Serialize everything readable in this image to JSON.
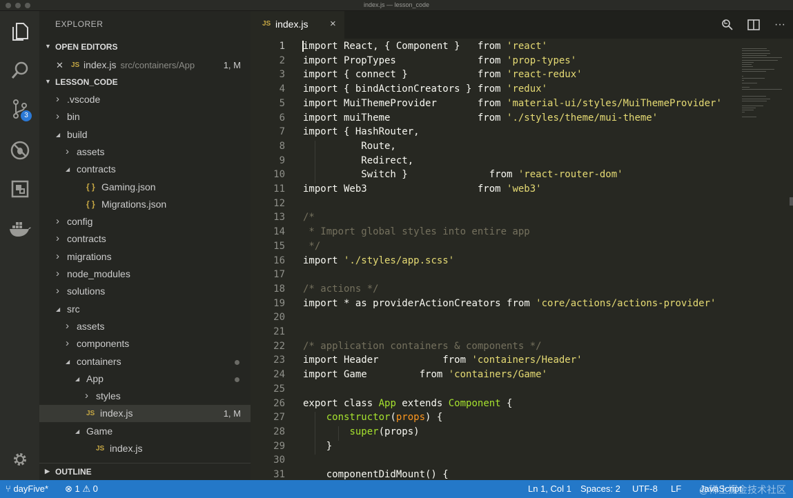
{
  "window": {
    "title": "index.js — lesson_code"
  },
  "activity": {
    "icons": [
      "files-icon",
      "search-icon",
      "source-control-icon",
      "debug-icon",
      "extensions-icon",
      "docker-icon",
      "settings-gear-icon"
    ],
    "scm_badge": "3"
  },
  "explorer": {
    "title": "EXPLORER",
    "open_editors_label": "OPEN EDITORS",
    "open_editor": {
      "icon": "JS",
      "name": "index.js",
      "path": "src/containers/App",
      "status": "1, M"
    },
    "project_label": "LESSON_CODE",
    "tree": [
      {
        "name": ".vscode",
        "kind": "folder",
        "open": false
      },
      {
        "name": "bin",
        "kind": "folder",
        "open": false
      },
      {
        "name": "build",
        "kind": "folder",
        "open": true
      },
      {
        "name": "assets",
        "kind": "folder",
        "open": false
      },
      {
        "name": "contracts",
        "kind": "folder",
        "open": true
      },
      {
        "name": "Gaming.json",
        "kind": "json",
        "icon": "{ }"
      },
      {
        "name": "Migrations.json",
        "kind": "json",
        "icon": "{ }"
      },
      {
        "name": "config",
        "kind": "folder",
        "open": false
      },
      {
        "name": "contracts",
        "kind": "folder",
        "open": false
      },
      {
        "name": "migrations",
        "kind": "folder",
        "open": false
      },
      {
        "name": "node_modules",
        "kind": "folder",
        "open": false
      },
      {
        "name": "solutions",
        "kind": "folder",
        "open": false
      },
      {
        "name": "src",
        "kind": "folder",
        "open": true
      },
      {
        "name": "assets",
        "kind": "folder",
        "open": false
      },
      {
        "name": "components",
        "kind": "folder",
        "open": false
      },
      {
        "name": "containers",
        "kind": "folder",
        "open": true
      },
      {
        "name": "App",
        "kind": "folder",
        "open": true
      },
      {
        "name": "styles",
        "kind": "folder",
        "open": false
      },
      {
        "name": "index.js",
        "kind": "js",
        "icon": "JS",
        "status": "1, M"
      },
      {
        "name": "Game",
        "kind": "folder",
        "open": true
      },
      {
        "name": "index.js",
        "kind": "js",
        "icon": "JS"
      }
    ],
    "outline_label": "OUTLINE"
  },
  "editor": {
    "tab": {
      "icon": "JS",
      "name": "index.js",
      "close": "×"
    },
    "line_numbers": [
      "1",
      "2",
      "3",
      "4",
      "5",
      "6",
      "7",
      "8",
      "9",
      "10",
      "11",
      "12",
      "13",
      "14",
      "15",
      "16",
      "17",
      "18",
      "19",
      "20",
      "21",
      "22",
      "23",
      "24",
      "25",
      "26",
      "27",
      "28",
      "29",
      "30",
      "31"
    ],
    "code": [
      [
        [
          "kw",
          "import"
        ],
        [
          "id",
          " React, { Component }   "
        ],
        [
          "kw",
          "from"
        ],
        [
          "st",
          " 'react'"
        ]
      ],
      [
        [
          "kw",
          "import"
        ],
        [
          "id",
          " PropTypes              "
        ],
        [
          "kw",
          "from"
        ],
        [
          "st",
          " 'prop-types'"
        ]
      ],
      [
        [
          "kw",
          "import"
        ],
        [
          "id",
          " { connect }            "
        ],
        [
          "kw",
          "from"
        ],
        [
          "st",
          " 'react-redux'"
        ]
      ],
      [
        [
          "kw",
          "import"
        ],
        [
          "id",
          " { bindActionCreators } "
        ],
        [
          "kw",
          "from"
        ],
        [
          "st",
          " 'redux'"
        ]
      ],
      [
        [
          "kw",
          "import"
        ],
        [
          "id",
          " MuiThemeProvider       "
        ],
        [
          "kw",
          "from"
        ],
        [
          "st",
          " 'material-ui/styles/MuiThemeProvider'"
        ]
      ],
      [
        [
          "kw",
          "import"
        ],
        [
          "id",
          " muiTheme               "
        ],
        [
          "kw",
          "from"
        ],
        [
          "st",
          " './styles/theme/mui-theme'"
        ]
      ],
      [
        [
          "kw",
          "import"
        ],
        [
          "id",
          " { HashRouter,"
        ]
      ],
      [
        [
          "id",
          "          Route,"
        ]
      ],
      [
        [
          "id",
          "          Redirect,"
        ]
      ],
      [
        [
          "id",
          "          Switch }              "
        ],
        [
          "kw",
          "from"
        ],
        [
          "st",
          " 'react-router-dom'"
        ]
      ],
      [
        [
          "kw",
          "import"
        ],
        [
          "id",
          " Web3                   "
        ],
        [
          "kw",
          "from"
        ],
        [
          "st",
          " 'web3'"
        ]
      ],
      [],
      [
        [
          "cm",
          "/*"
        ]
      ],
      [
        [
          "cm",
          " * Import global styles into entire app"
        ]
      ],
      [
        [
          "cm",
          " */"
        ]
      ],
      [
        [
          "kw",
          "import"
        ],
        [
          "st",
          " './styles/app.scss'"
        ]
      ],
      [],
      [
        [
          "cm",
          "/* actions */"
        ]
      ],
      [
        [
          "kw",
          "import"
        ],
        [
          "kw",
          " *"
        ],
        [
          "kw",
          " as"
        ],
        [
          "id",
          " providerActionCreators "
        ],
        [
          "kw",
          "from"
        ],
        [
          "st",
          " 'core/actions/actions-provider'"
        ]
      ],
      [],
      [],
      [
        [
          "cm",
          "/* application containers & components */"
        ]
      ],
      [
        [
          "kw",
          "import"
        ],
        [
          "id",
          " Header           "
        ],
        [
          "kw",
          "from"
        ],
        [
          "st",
          " 'containers/Header'"
        ]
      ],
      [
        [
          "kw",
          "import"
        ],
        [
          "id",
          " Game         "
        ],
        [
          "kw",
          "from"
        ],
        [
          "st",
          " 'containers/Game'"
        ]
      ],
      [],
      [
        [
          "kw",
          "export"
        ],
        [
          "kw",
          " class"
        ],
        [
          "fn",
          " App"
        ],
        [
          "kw",
          " extends"
        ],
        [
          "fn",
          " Component"
        ],
        [
          "id",
          " {"
        ]
      ],
      [
        [
          "id",
          "    "
        ],
        [
          "fn",
          "constructor"
        ],
        [
          "id",
          "("
        ],
        [
          "pr",
          "props"
        ],
        [
          "id",
          ") {"
        ]
      ],
      [
        [
          "id",
          "        "
        ],
        [
          "fn",
          "super"
        ],
        [
          "id",
          "(props)"
        ]
      ],
      [
        [
          "id",
          "    }"
        ]
      ],
      [],
      [
        [
          "id",
          "    componentDidMount() {"
        ]
      ]
    ],
    "syntax_colors": {
      "kw": "#f8f8f2",
      "id": "#f8f8f2",
      "st": "#e6db74",
      "cm": "#75715e",
      "fn": "#a6e22e",
      "pr": "#fd971f"
    }
  },
  "status": {
    "branch": "dayFive*",
    "errors": "1",
    "warnings": "0",
    "cursor": "Ln 1, Col 1",
    "spaces": "Spaces: 2",
    "encoding": "UTF-8",
    "eol": "LF",
    "language": "JavaScript",
    "watermark": "@稀土掘金技术社区"
  }
}
